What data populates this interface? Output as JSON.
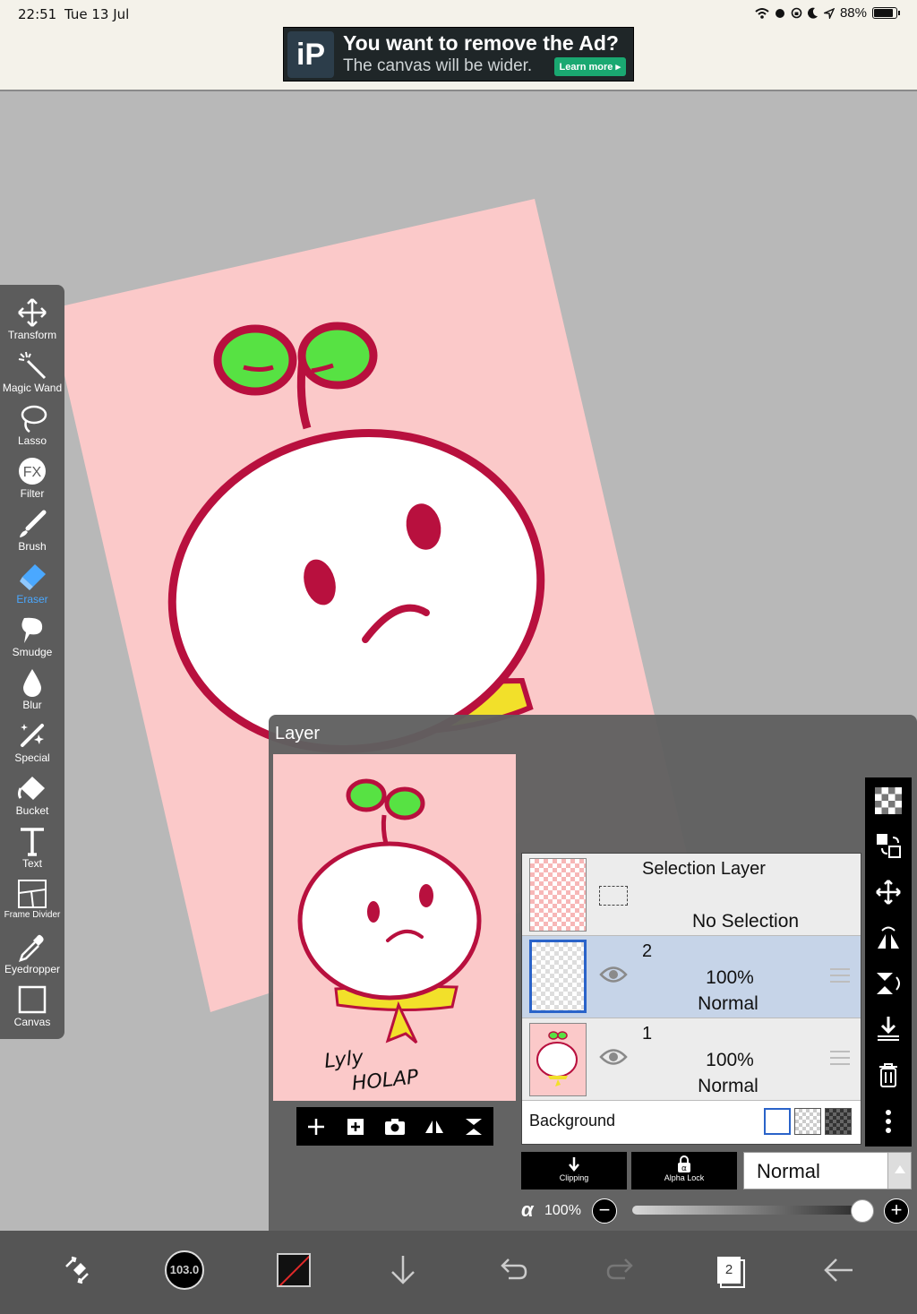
{
  "status_bar": {
    "time": "22:51",
    "date": "Tue 13 Jul",
    "battery": "88%",
    "battery_level": 0.88
  },
  "ad": {
    "logo": "iP",
    "title": "You want to remove the Ad?",
    "subtitle": "The canvas will be wider.",
    "button": "Learn more ▸"
  },
  "tools": [
    {
      "label": "Transform",
      "icon": "move-icon"
    },
    {
      "label": "Magic Wand",
      "icon": "magic-wand-icon"
    },
    {
      "label": "Lasso",
      "icon": "lasso-icon"
    },
    {
      "label": "Filter",
      "icon": "fx-icon"
    },
    {
      "label": "Brush",
      "icon": "brush-icon"
    },
    {
      "label": "Eraser",
      "icon": "eraser-icon",
      "active": true
    },
    {
      "label": "Smudge",
      "icon": "smudge-icon"
    },
    {
      "label": "Blur",
      "icon": "drop-icon"
    },
    {
      "label": "Special",
      "icon": "special-brush-icon"
    },
    {
      "label": "Bucket",
      "icon": "bucket-icon"
    },
    {
      "label": "Text",
      "icon": "text-icon"
    },
    {
      "label": "Frame Divider",
      "icon": "frame-divider-icon"
    },
    {
      "label": "Eyedropper",
      "icon": "eyedropper-icon"
    },
    {
      "label": "Canvas",
      "icon": "canvas-icon"
    }
  ],
  "layer_panel": {
    "title": "Layer",
    "selection_layer": {
      "name": "Selection Layer",
      "status": "No Selection"
    },
    "layers": [
      {
        "name": "2",
        "opacity": "100%",
        "blend": "Normal",
        "selected": true
      },
      {
        "name": "1",
        "opacity": "100%",
        "blend": "Normal",
        "selected": false
      }
    ],
    "background_label": "Background",
    "clipping_label": "Clipping",
    "alpha_lock_label": "Alpha Lock",
    "blend_mode": "Normal",
    "alpha_symbol": "α",
    "alpha_value": "100%",
    "alpha_level": 1.0
  },
  "artwork": {
    "signature_text": "Lyly HOLAP"
  },
  "bottom_bar": {
    "brush_size": "103.0",
    "layer_count": "2"
  },
  "colors": {
    "accent": "#4aa8ff",
    "paper": "#fbc9c9",
    "outline": "#b8103e",
    "leaf": "#57e243",
    "scarf": "#f2e02a",
    "selected_row": "#c6d4e8"
  }
}
